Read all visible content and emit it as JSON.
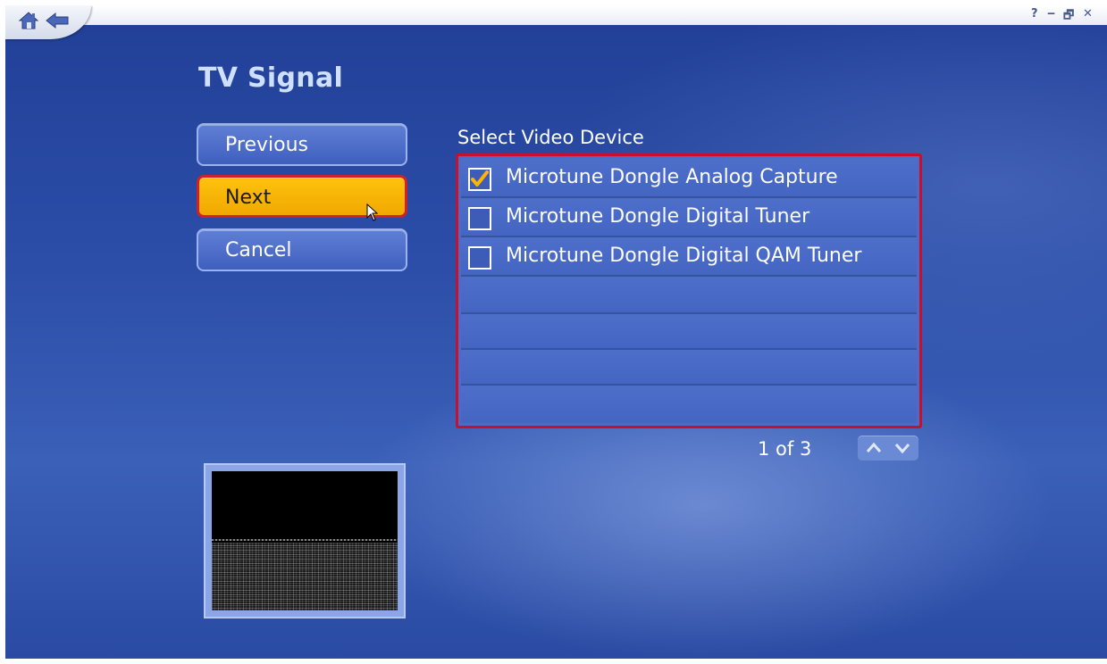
{
  "window": {
    "controls": {
      "help": "?",
      "minimize": "‒",
      "restore": "🗗",
      "close": "✕"
    }
  },
  "page": {
    "title": "TV Signal"
  },
  "buttons": {
    "previous": "Previous",
    "next": "Next",
    "cancel": "Cancel"
  },
  "device_list": {
    "label": "Select Video Device",
    "items": [
      {
        "label": "Microtune Dongle Analog Capture",
        "checked": true
      },
      {
        "label": "Microtune Dongle Digital Tuner",
        "checked": false
      },
      {
        "label": "Microtune Dongle Digital QAM Tuner",
        "checked": false
      }
    ],
    "pager": "1 of 3"
  },
  "colors": {
    "focus_button": "#ffc20e",
    "focus_border": "#c8102e",
    "background": "#2c4ea8",
    "checkmark": "#ffb400"
  },
  "icons": [
    "home-icon",
    "back-arrow-icon",
    "check-icon",
    "scroll-up-icon",
    "scroll-down-icon"
  ]
}
